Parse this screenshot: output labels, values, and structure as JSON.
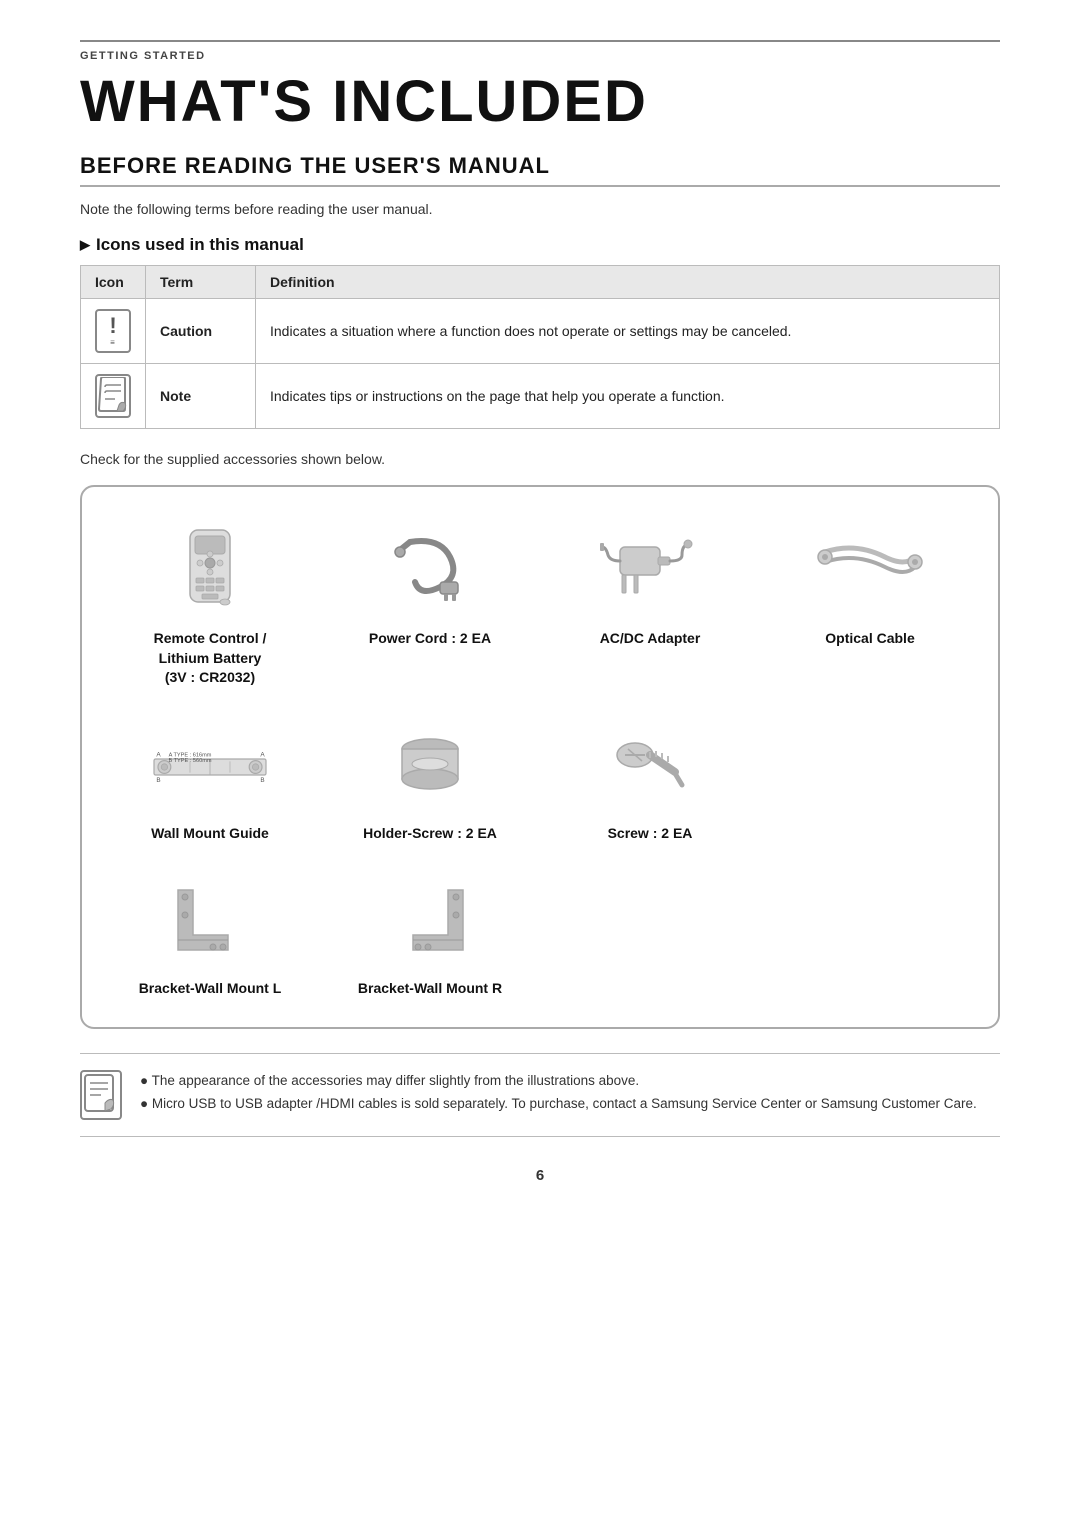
{
  "breadcrumb": "GETTING STARTED",
  "page_title": "WHAT'S INCLUDED",
  "section_title": "BEFORE READING THE USER'S MANUAL",
  "intro_text": "Note the following terms before reading the user manual.",
  "icons_section_heading": "Icons used in this manual",
  "icon_table": {
    "columns": [
      "Icon",
      "Term",
      "Definition"
    ],
    "rows": [
      {
        "icon": "caution",
        "term": "Caution",
        "definition": "Indicates a situation where a function does not operate or settings may be canceled."
      },
      {
        "icon": "note",
        "term": "Note",
        "definition": "Indicates tips or instructions on the page that help you operate a function."
      }
    ]
  },
  "accessories_intro": "Check for the supplied accessories shown below.",
  "accessories": {
    "row1": [
      {
        "id": "remote-control",
        "label": "Remote Control /\nLithium Battery\n(3V : CR2032)"
      },
      {
        "id": "power-cord",
        "label": "Power Cord : 2 EA"
      },
      {
        "id": "ac-adapter",
        "label": "AC/DC Adapter"
      },
      {
        "id": "optical-cable",
        "label": "Optical Cable"
      }
    ],
    "row2": [
      {
        "id": "wall-mount-guide",
        "label": "Wall Mount Guide"
      },
      {
        "id": "holder-screw",
        "label": "Holder-Screw : 2 EA"
      },
      {
        "id": "screw",
        "label": "Screw : 2 EA"
      },
      {
        "id": "empty",
        "label": ""
      }
    ],
    "row3": [
      {
        "id": "bracket-wall-mount-l",
        "label": "Bracket-Wall Mount L"
      },
      {
        "id": "bracket-wall-mount-r",
        "label": "Bracket-Wall Mount R"
      },
      {
        "id": "empty2",
        "label": ""
      },
      {
        "id": "empty3",
        "label": ""
      }
    ]
  },
  "note_bullets": [
    "The appearance of the accessories may differ slightly from the illustrations above.",
    "Micro USB to USB adapter /HDMI cables is sold separately. To purchase, contact a Samsung Service Center or Samsung Customer Care."
  ],
  "page_number": "6"
}
